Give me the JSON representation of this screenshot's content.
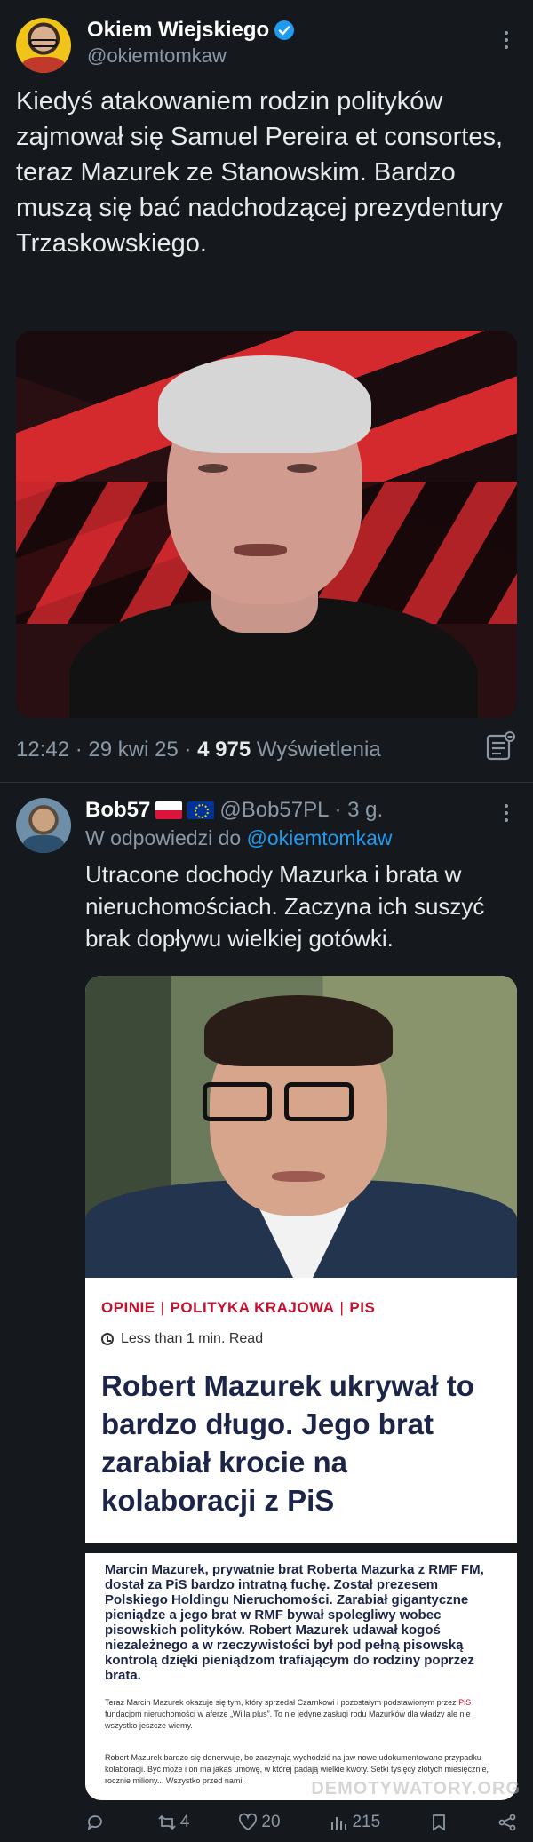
{
  "main_tweet": {
    "display_name": "Okiem Wiejskiego",
    "handle": "@okiemtomkaw",
    "text": "Kiedyś atakowaniem rodzin polityków zajmował się Samuel Pereira et consortes, teraz Mazurek ze Stanowskim. Bardzo muszą się bać nadchodzącej prezydentury Trzaskowskiego.",
    "time": "12:42 · 29 kwi 25 · ",
    "views_count": "4 975",
    "views_label": " Wyświetlenia"
  },
  "reply": {
    "display_name": "Bob57",
    "handle": "@Bob57PL",
    "age": "· 3 g.",
    "in_reply_prefix": "W odpowiedzi do ",
    "in_reply_mention": "@okiemtomkaw",
    "text": "Utracone dochody Mazurka i brata w nieruchomościach. Zaczyna ich suszyć brak dopływu wielkiej gotówki.",
    "article": {
      "cat1": "OPINIE",
      "cat2": "POLITYKA KRAJOWA",
      "cat3": "PIS",
      "read_time": "Less than 1 min. Read",
      "title": "Robert Mazurek ukrywał to bardzo długo. Jego brat zarabiał krocie na kolaboracji z PiS",
      "lead": "Marcin Mazurek, prywatnie brat Roberta Mazurka z RMF FM, dostał za PiS bardzo intratną fuchę. Został prezesem Polskiego Holdingu Nieruchomości. Zarabiał gigantyczne pieniądze a jego brat w RMF bywał spolegliwy wobec pisowskich polityków. Robert Mazurek udawał kogoś niezależnego a w rzeczywistości był pod pełną pisowską kontrolą dzięki pieniądzom trafiającym do rodziny poprzez brata.",
      "body1_a": "Teraz Marcin Mazurek okazuje się tym, który sprzedał Czarnkowi i pozostałym podstawionym przez ",
      "body1_red": "PiS",
      "body1_b": " fundacjom nieruchomości w aferze „Willa plus”. To nie jedyne zasługi rodu Mazurków dla władzy ale nie wszystko jeszcze wiemy.",
      "body2": "Robert Mazurek bardzo się denerwuje, bo zaczynają wychodzić na jaw nowe udokumentowane przypadku kolaboracji. Być może i on ma jakąś umowę, w której padają wielkie kwoty. Setki tysięcy złotych miesięcznie, rocznie miliony... Wszystko przed nami."
    },
    "actions": {
      "replies": "",
      "reposts": "4",
      "likes": "20",
      "views": "215"
    }
  },
  "watermark": "DEMOTYWATORY.ORG",
  "colors": {
    "background": "#15181c",
    "link": "#1d9bf0",
    "muted": "#8b98a5",
    "article_red": "#c8102e",
    "article_navy": "#1c2447"
  }
}
